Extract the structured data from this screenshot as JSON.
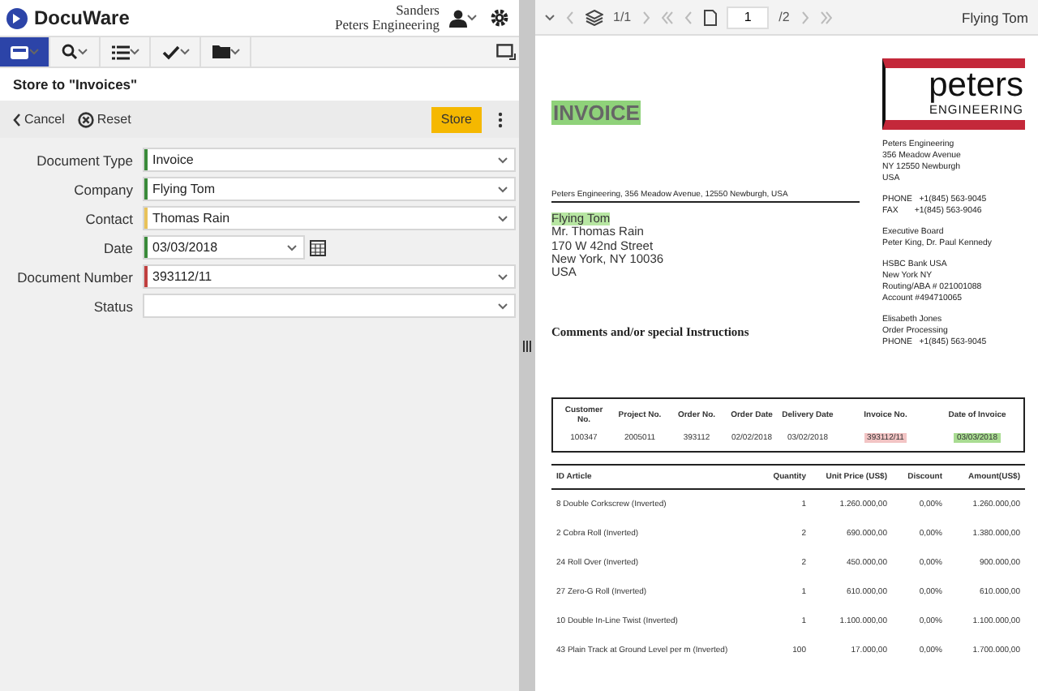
{
  "app": {
    "name": "DocuWare",
    "user": "Sanders",
    "organization": "Peters Engineering"
  },
  "nav_tabs": [
    {
      "kind": "tray",
      "selected": true
    },
    {
      "kind": "search",
      "selected": false
    },
    {
      "kind": "list",
      "selected": false
    },
    {
      "kind": "tasks",
      "selected": false
    },
    {
      "kind": "folder",
      "selected": false
    }
  ],
  "store_title": "Store to \"Invoices\"",
  "actions": {
    "cancel": "Cancel",
    "reset": "Reset",
    "store": "Store"
  },
  "fields": [
    {
      "label": "Document Type",
      "value": "Invoice",
      "kind": "select",
      "color": "#3a8a3a"
    },
    {
      "label": "Company",
      "value": "Flying Tom",
      "kind": "select",
      "color": "#3a8a3a"
    },
    {
      "label": "Contact",
      "value": "Thomas Rain",
      "kind": "select",
      "color": "#e8c25a"
    },
    {
      "label": "Date",
      "value": "03/03/2018",
      "kind": "date",
      "color": "#3a8a3a"
    },
    {
      "label": "Document Number",
      "value": "393112/11",
      "kind": "select",
      "color": "#c04040"
    },
    {
      "label": "Status",
      "kind": "select"
    }
  ],
  "viewer": {
    "layers": "1/1",
    "page": "1",
    "pages": "/2",
    "document_name": "Flying Tom"
  },
  "invoice": {
    "title": "INVOICE",
    "sender_line": "Peters Engineering, 356 Meadow Avenue, 12550 Newburgh, USA",
    "recipient": [
      {
        "text": "Flying Tom",
        "highlighted": true
      },
      {
        "text": "Mr. Thomas Rain",
        "highlighted": false
      },
      {
        "text": "170 W 42nd Street",
        "highlighted": false
      },
      {
        "text": "New York, NY 10036",
        "highlighted": false
      },
      {
        "text": "USA",
        "highlighted": false
      }
    ],
    "comments_heading": "Comments and/or special Instructions",
    "logo": {
      "main": "peters",
      "sub": "ENGINEERING"
    },
    "company_blocks": [
      [
        "Peters Engineering",
        "356 Meadow Avenue",
        "NY 12550 Newburgh",
        "USA"
      ],
      [
        "PHONE   +1(845) 563-9045",
        "FAX       +1(845) 563-9046"
      ],
      [
        "Executive Board",
        "Peter King, Dr. Paul Kennedy"
      ],
      [
        "HSBC Bank USA",
        "New York NY",
        "Routing/ABA # 021001088",
        "Account #494710065"
      ],
      [
        "Elisabeth Jones",
        "Order Processing",
        "PHONE   +1(845) 563-9045"
      ]
    ],
    "order_table": {
      "columns": [
        "Customer No.",
        "Project No.",
        "Order No.",
        "Order Date",
        "Delivery Date",
        "Invoice No.",
        "Date of Invoice"
      ],
      "cells": [
        {
          "text": "100347"
        },
        {
          "text": "2005011"
        },
        {
          "text": "393112"
        },
        {
          "text": "02/02/2018"
        },
        {
          "text": "03/02/2018"
        },
        {
          "text": "393112/11",
          "color": "#f2c4c4"
        },
        {
          "text": "03/03/2018",
          "color": "#a9dc92"
        }
      ]
    },
    "items_table": {
      "columns": [
        "ID  Article",
        "Quantity",
        "Unit Price (US$)",
        "Discount",
        "Amount(US$)"
      ],
      "rows": [
        [
          "8  Double Corkscrew (Inverted)",
          "1",
          "1.260.000,00",
          "0,00%",
          "1.260.000,00"
        ],
        [
          "2  Cobra Roll (Inverted)",
          "2",
          "690.000,00",
          "0,00%",
          "1.380.000,00"
        ],
        [
          "24  Roll Over (Inverted)",
          "2",
          "450.000,00",
          "0,00%",
          "900.000,00"
        ],
        [
          "27  Zero-G Roll (Inverted)",
          "1",
          "610.000,00",
          "0,00%",
          "610.000,00"
        ],
        [
          "10  Double In-Line Twist (Inverted)",
          "1",
          "1.100.000,00",
          "0,00%",
          "1.100.000,00"
        ],
        [
          "43  Plain Track at Ground Level per m (Inverted)",
          "100",
          "17.000,00",
          "0,00%",
          "1.700.000,00"
        ]
      ]
    }
  }
}
